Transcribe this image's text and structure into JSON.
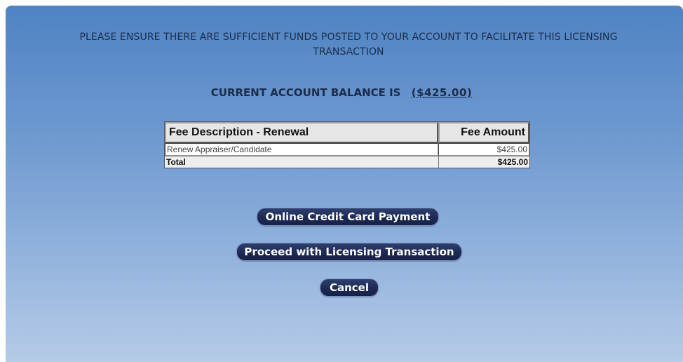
{
  "notice": {
    "line1": "PLEASE ENSURE THERE ARE SUFFICIENT FUNDS POSTED TO YOUR ACCOUNT TO FACILITATE THIS LICENSING",
    "line2": "TRANSACTION"
  },
  "balance": {
    "label": "CURRENT ACCOUNT BALANCE IS",
    "amount": "($425.00)"
  },
  "fee_table": {
    "headers": {
      "description": "Fee Description - Renewal",
      "amount": "Fee Amount"
    },
    "rows": [
      {
        "description": "Renew Appraiser/Candidate",
        "amount": "$425.00"
      }
    ],
    "total": {
      "label": "Total",
      "amount": "$425.00"
    }
  },
  "buttons": {
    "credit_card": "Online Credit Card Payment",
    "proceed": "Proceed with Licensing Transaction",
    "cancel": "Cancel"
  },
  "colors": {
    "panel_top": "#4f83c3",
    "panel_bottom": "#b5cbe7",
    "button_bg": "#1d2a55",
    "text": "#1b2c4a"
  }
}
